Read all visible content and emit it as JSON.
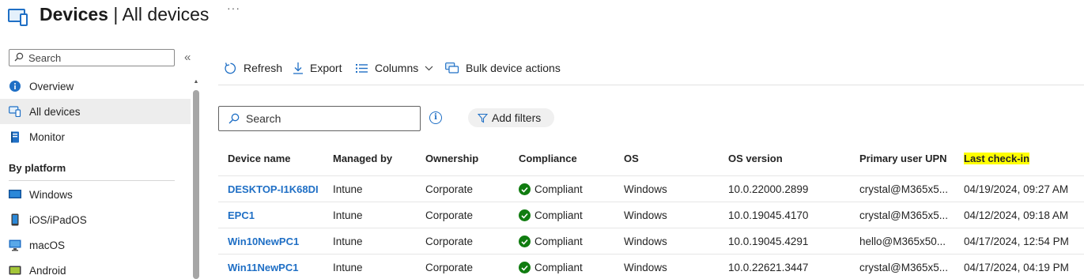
{
  "header": {
    "title_bold": "Devices",
    "title_sep": " | ",
    "title_rest": "All devices",
    "more": "···"
  },
  "sidebar": {
    "search_placeholder": "Search",
    "collapse": "«",
    "items": [
      {
        "label": "Overview",
        "icon": "info-icon",
        "selected": false
      },
      {
        "label": "All devices",
        "icon": "devices-icon",
        "selected": true
      },
      {
        "label": "Monitor",
        "icon": "monitor-book-icon",
        "selected": false
      }
    ],
    "section": "By platform",
    "platforms": [
      {
        "label": "Windows",
        "icon": "windows-icon"
      },
      {
        "label": "iOS/iPadOS",
        "icon": "phone-icon"
      },
      {
        "label": "macOS",
        "icon": "desktop-icon"
      },
      {
        "label": "Android",
        "icon": "android-icon"
      }
    ]
  },
  "toolbar": {
    "refresh": "Refresh",
    "export": "Export",
    "columns": "Columns",
    "bulk": "Bulk device actions"
  },
  "filters": {
    "search_placeholder": "Search",
    "info": "i",
    "add_filters": "Add filters"
  },
  "table": {
    "columns": [
      "Device name",
      "Managed by",
      "Ownership",
      "Compliance",
      "OS",
      "OS version",
      "Primary user UPN",
      "Last check-in"
    ],
    "highlighted_column": "Last check-in",
    "rows": [
      {
        "name": "DESKTOP-I1K68DI",
        "managed": "Intune",
        "ownership": "Corporate",
        "compliance": "Compliant",
        "os": "Windows",
        "version": "10.0.22000.2899",
        "upn": "crystal@M365x5...",
        "checkin": "04/19/2024, 09:27 AM"
      },
      {
        "name": "EPC1",
        "managed": "Intune",
        "ownership": "Corporate",
        "compliance": "Compliant",
        "os": "Windows",
        "version": "10.0.19045.4170",
        "upn": "crystal@M365x5...",
        "checkin": "04/12/2024, 09:18 AM"
      },
      {
        "name": "Win10NewPC1",
        "managed": "Intune",
        "ownership": "Corporate",
        "compliance": "Compliant",
        "os": "Windows",
        "version": "10.0.19045.4291",
        "upn": "hello@M365x50...",
        "checkin": "04/17/2024, 12:54 PM"
      },
      {
        "name": "Win11NewPC1",
        "managed": "Intune",
        "ownership": "Corporate",
        "compliance": "Compliant",
        "os": "Windows",
        "version": "10.0.22621.3447",
        "upn": "crystal@M365x5...",
        "checkin": "04/17/2024, 04:19 PM"
      }
    ]
  },
  "colors": {
    "accent": "#1f6fc5",
    "compliant": "#107c10",
    "highlight": "#ffff00",
    "selected_bg": "#ededed"
  }
}
